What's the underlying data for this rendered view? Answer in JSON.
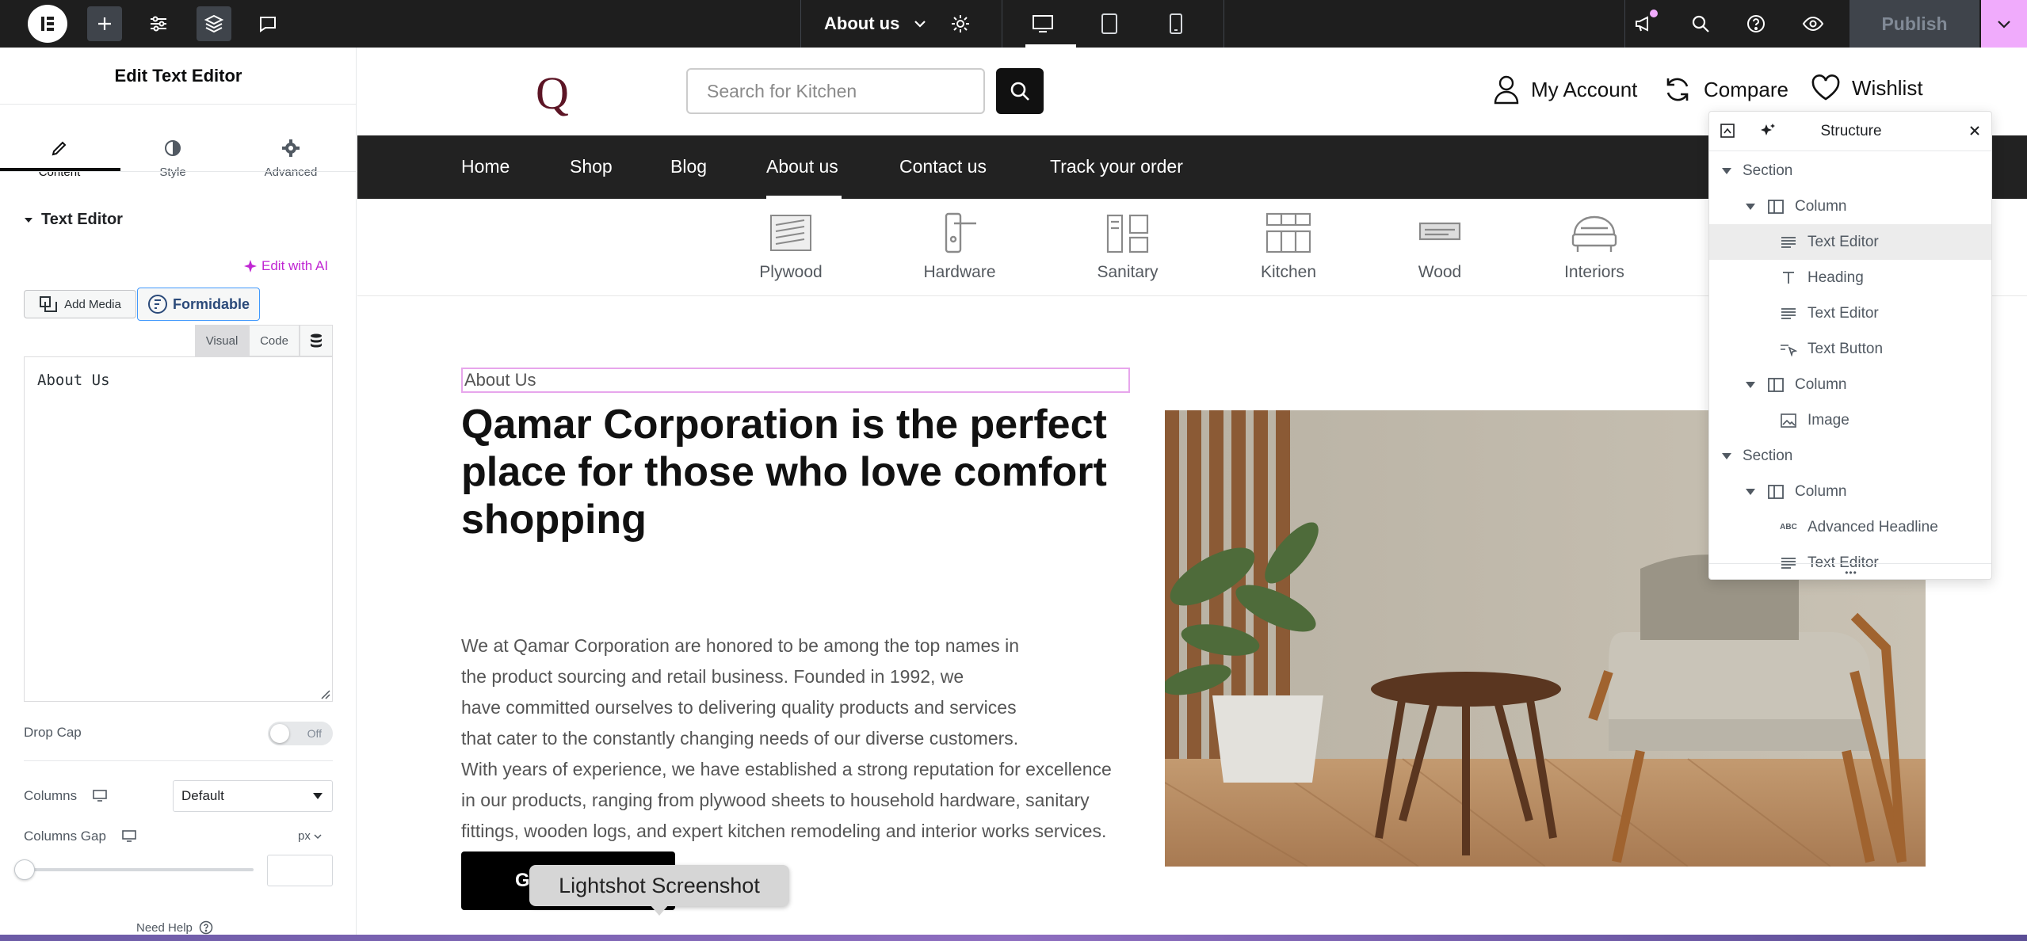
{
  "topbar": {
    "page_name": "About us",
    "publish_label": "Publish"
  },
  "panel": {
    "title": "Edit Text Editor",
    "tabs": [
      {
        "label": "Content"
      },
      {
        "label": "Style"
      },
      {
        "label": "Advanced"
      }
    ],
    "section_title": "Text Editor",
    "edit_ai": "Edit with AI",
    "add_media": "Add Media",
    "formidable": "Formidable",
    "visual_tab": "Visual",
    "code_tab": "Code",
    "editor_content": "About Us",
    "drop_cap_label": "Drop Cap",
    "drop_cap_state": "Off",
    "columns_label": "Columns",
    "columns_value": "Default",
    "columns_gap_label": "Columns Gap",
    "unit": "px",
    "need_help": "Need Help"
  },
  "site": {
    "logo": "Q",
    "search_placeholder": "Search for Kitchen",
    "header_links": [
      {
        "label": "My Account"
      },
      {
        "label": "Compare"
      },
      {
        "label": "Wishlist"
      }
    ],
    "nav": [
      {
        "label": "Home"
      },
      {
        "label": "Shop"
      },
      {
        "label": "Blog"
      },
      {
        "label": "About us"
      },
      {
        "label": "Contact us"
      },
      {
        "label": "Track your order"
      }
    ],
    "categories": [
      {
        "label": "Plywood",
        "icon": "plywood-icon"
      },
      {
        "label": "Hardware",
        "icon": "hardware-icon"
      },
      {
        "label": "Sanitary",
        "icon": "sanitary-icon"
      },
      {
        "label": "Kitchen",
        "icon": "kitchen-icon"
      },
      {
        "label": "Wood",
        "icon": "wood-icon"
      },
      {
        "label": "Interiors",
        "icon": "interiors-icon"
      }
    ],
    "about_label": "About Us",
    "heading_lines": [
      "Qamar Corporation is the perfect",
      "place for those who love comfort",
      "shopping"
    ],
    "body_lines": [
      "We at Qamar Corporation are honored to be among the top names in",
      "the product sourcing and retail business. Founded in 1992, we",
      "have committed ourselves to delivering quality products and services",
      "that cater to the constantly changing needs of our diverse customers.",
      "With years of experience, we have established a strong reputation for excellence",
      "in our products, ranging from plywood sheets to household hardware, sanitary",
      "fittings, wooden logs, and expert kitchen remodeling and interior works services."
    ],
    "button_partial": "G"
  },
  "structure": {
    "title": "Structure",
    "rows": [
      {
        "label": "Section",
        "level": 0,
        "type": "section"
      },
      {
        "label": "Column",
        "level": 1,
        "type": "column"
      },
      {
        "label": "Text Editor",
        "level": 2,
        "type": "text"
      },
      {
        "label": "Heading",
        "level": 2,
        "type": "heading"
      },
      {
        "label": "Text Editor",
        "level": 2,
        "type": "text"
      },
      {
        "label": "Text Button",
        "level": 2,
        "type": "button"
      },
      {
        "label": "Column",
        "level": 1,
        "type": "column"
      },
      {
        "label": "Image",
        "level": 2,
        "type": "image"
      },
      {
        "label": "Section",
        "level": 0,
        "type": "section"
      },
      {
        "label": "Column",
        "level": 1,
        "type": "column"
      },
      {
        "label": "Advanced Headline",
        "level": 2,
        "type": "headline"
      },
      {
        "label": "Text Editor",
        "level": 2,
        "type": "text"
      }
    ]
  },
  "tooltip": "Lightshot Screenshot",
  "colors": {
    "accent": "#d004d4",
    "dark": "#1e1e1e",
    "nav": "#222222"
  }
}
